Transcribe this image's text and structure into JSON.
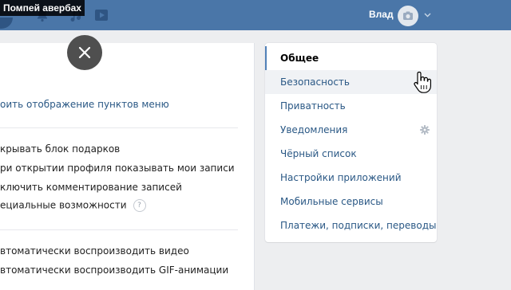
{
  "overlay": {
    "title": "Помпей авербах"
  },
  "header": {
    "user_name": "Влад",
    "icons": [
      "bell-icon",
      "music-icon",
      "video-icon",
      "camera-icon",
      "chevron-down-icon"
    ],
    "brand_color": "#4a76a8"
  },
  "main": {
    "menu_link": "оить отображение пунктов меню",
    "options_group_1": [
      "крывать блок подарков",
      "ри открытии профиля показывать мои записи",
      "ключить комментирование записей",
      "ециальные возможности"
    ],
    "help_icon_label": "?",
    "options_group_2": [
      "втоматически воспроизводить видео",
      "втоматически воспроизводить GIF-анимации"
    ]
  },
  "settings_menu": {
    "items": [
      "Общее",
      "Безопасность",
      "Приватность",
      "Уведомления",
      "Чёрный список",
      "Настройки приложений",
      "Мобильные сервисы",
      "Платежи, подписки, переводы"
    ],
    "active_index": 0,
    "hover_index": 1,
    "accent_color": "#5181b8"
  }
}
